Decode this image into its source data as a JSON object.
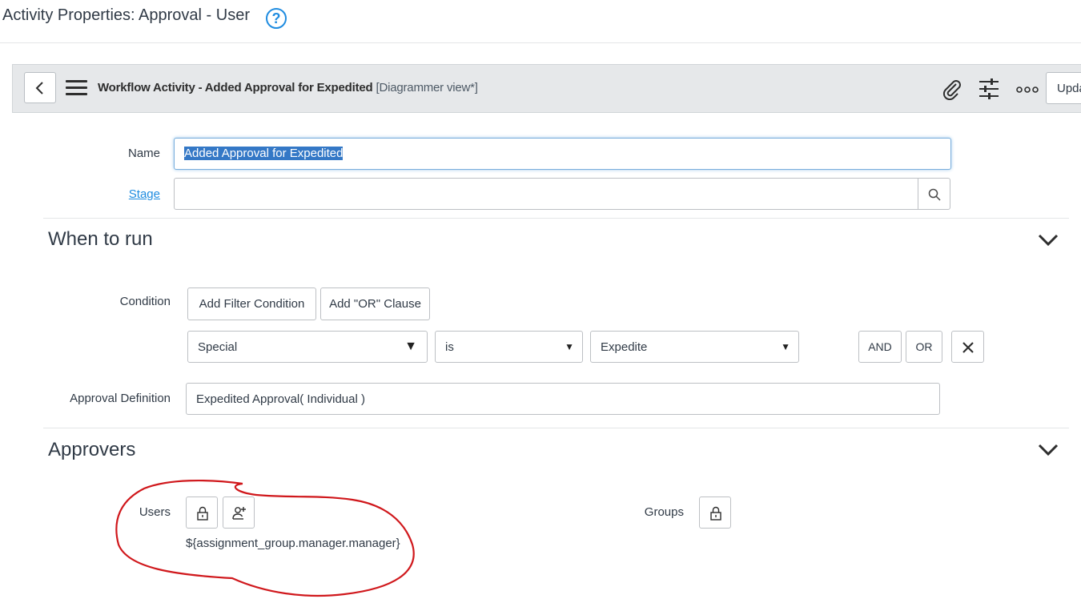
{
  "page": {
    "title": "Activity Properties: Approval - User",
    "help_icon": "question-circle-icon"
  },
  "header": {
    "title": "Workflow Activity - Added Approval for Expedited",
    "view": "[Diagrammer view*]",
    "update_label": "Upda",
    "icons": [
      "back-chevron-icon",
      "hamburger-menu-icon",
      "paperclip-icon",
      "sliders-icon",
      "more-dots-icon"
    ]
  },
  "form": {
    "name_label": "Name",
    "name_value": "Added Approval for Expedited",
    "stage_label": "Stage",
    "stage_value": ""
  },
  "when_to_run": {
    "title": "When to run",
    "condition_label": "Condition",
    "add_filter_label": "Add Filter Condition",
    "add_or_label": "Add \"OR\" Clause",
    "field_value": "Special",
    "operator_value": "is",
    "value_value": "Expedite",
    "and_label": "AND",
    "or_label": "OR",
    "approval_definition_label": "Approval Definition",
    "approval_definition_value": "Expedited Approval( Individual )"
  },
  "approvers": {
    "title": "Approvers",
    "users_label": "Users",
    "users_value": "${assignment_group.manager.manager}",
    "groups_label": "Groups"
  },
  "colors": {
    "accent": "#1f8ce0",
    "annotation": "#d0181c",
    "header_bg": "#e6e8ea"
  }
}
